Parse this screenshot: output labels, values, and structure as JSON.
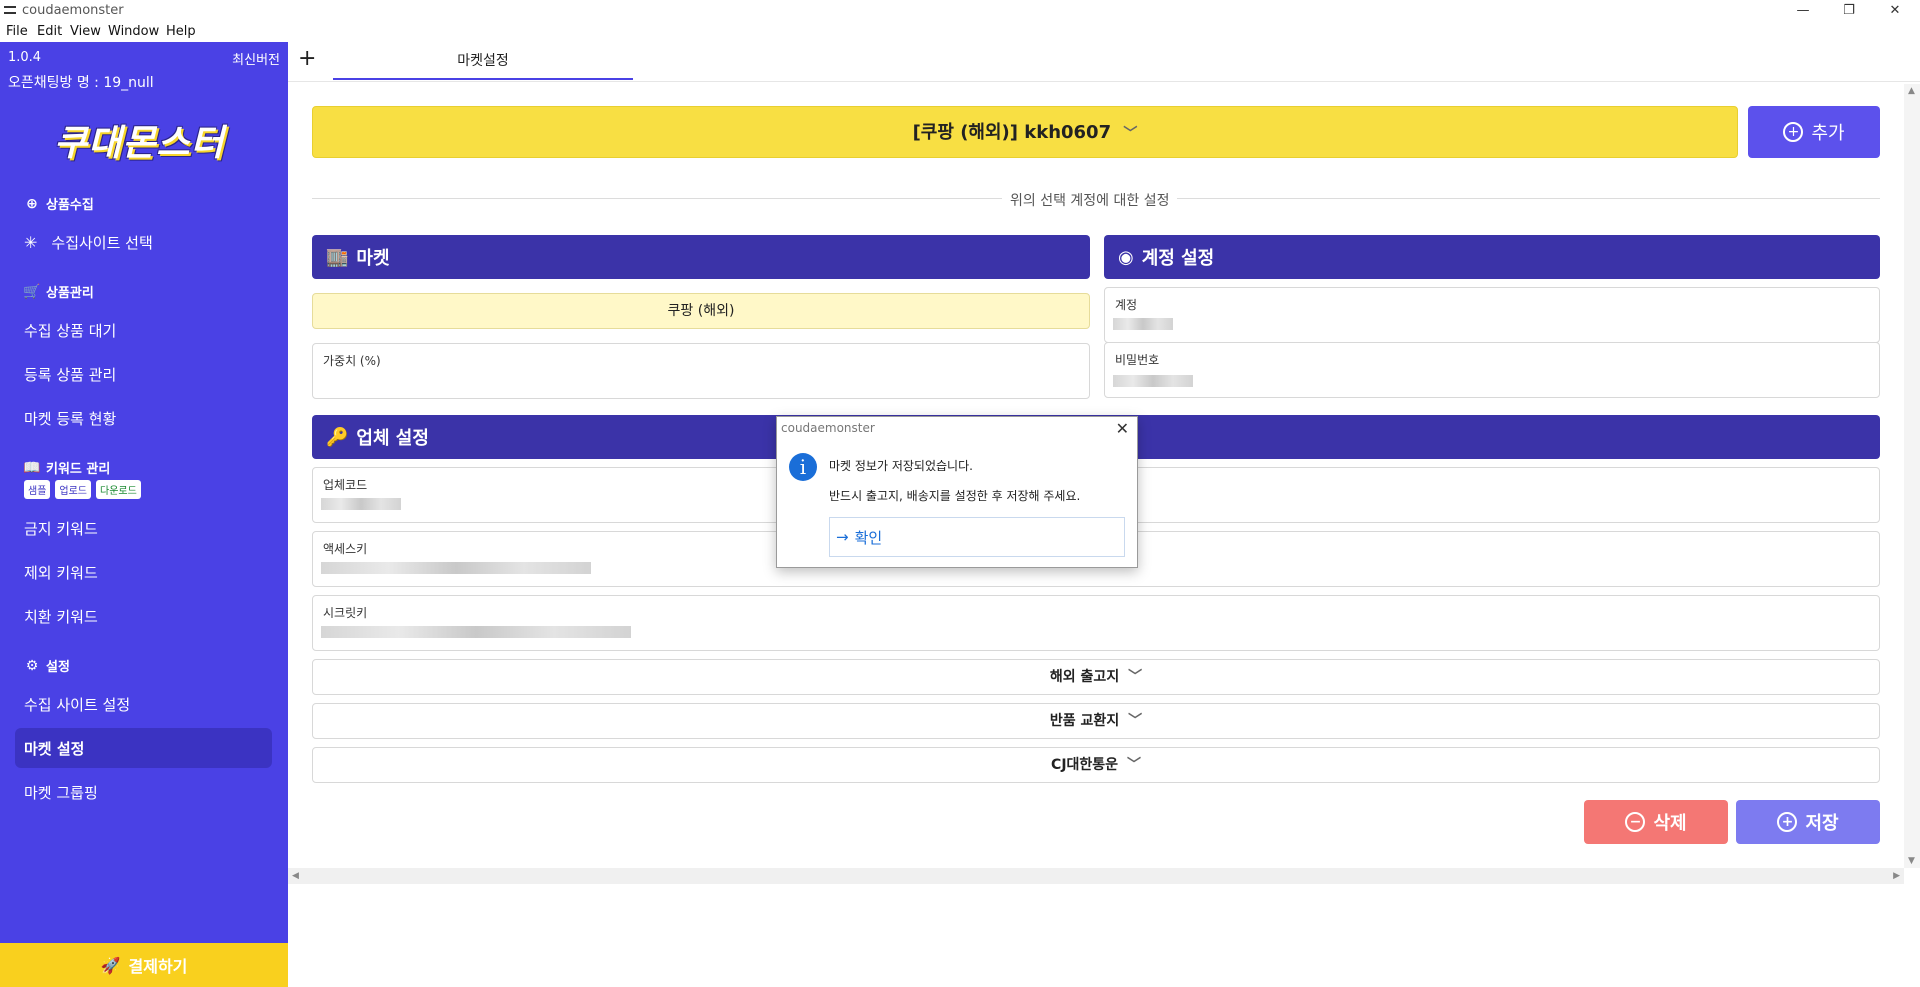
{
  "window": {
    "title": "coudaemonster",
    "min": "—",
    "restore": "❐",
    "close": "✕"
  },
  "menu": [
    "File",
    "Edit",
    "View",
    "Window",
    "Help"
  ],
  "sidebar": {
    "version": "1.0.4",
    "latest": "최신버전",
    "room": "오픈채팅방 명 : 19_null",
    "logo": "쿠대몬스터",
    "sections": {
      "collect": "상품수집",
      "manage": "상품관리",
      "keyword": "키워드 관리",
      "settings": "설정"
    },
    "items": {
      "site_select": "수집사이트 선택",
      "collect_wait": "수집 상품 대기",
      "registered": "등록 상품 관리",
      "market_status": "마켓 등록 현황",
      "banned_kw": "금지 키워드",
      "excluded_kw": "제외 키워드",
      "replace_kw": "치환 키워드",
      "site_settings": "수집 사이트 설정",
      "market_settings": "마켓 설정",
      "market_group": "마켓 그룹핑"
    },
    "kw_tags": [
      "샘플",
      "업로드",
      "다운로드"
    ],
    "pay": "결제하기"
  },
  "tabs": {
    "add": "+",
    "active": "마켓설정"
  },
  "account": {
    "selected": "[쿠팡 (해외)] kkh0607",
    "add": "추가",
    "divider": "위의 선택 계정에 대한 설정"
  },
  "market_panel": {
    "title": "마켓",
    "market": "쿠팡 (해외)",
    "weight_label": "가중치 (%)"
  },
  "account_panel": {
    "title": "계정 설정",
    "id_label": "계정",
    "pw_label": "비밀번호"
  },
  "vendor_panel": {
    "title": "업체 설정",
    "code_label": "업체코드",
    "access_label": "액세스키",
    "secret_label": "시크릿키"
  },
  "collapsibles": [
    "해외 출고지",
    "반품 교환지",
    "CJ대한통운"
  ],
  "actions": {
    "delete": "삭제",
    "save": "저장"
  },
  "dialog": {
    "title": "coudaemonster",
    "message1": "마켓 정보가 저장되었습니다.",
    "message2": "반드시 출고지, 배송지를 설정한 후 저장해 주세요.",
    "ok": "확인"
  },
  "colors": {
    "sidebar": "#4a41e5",
    "accent_yellow": "#f8df43",
    "panel_header": "#3b33a8",
    "delete": "#f47774",
    "save": "#7d7bf0"
  }
}
